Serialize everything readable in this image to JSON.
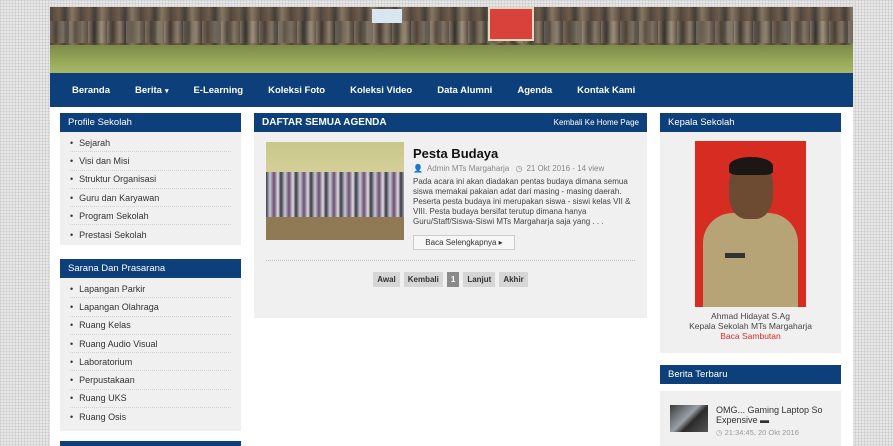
{
  "nav": {
    "items": [
      {
        "label": "Beranda"
      },
      {
        "label": "Berita",
        "caret": "▾"
      },
      {
        "label": "E-Learning"
      },
      {
        "label": "Koleksi Foto"
      },
      {
        "label": "Koleksi Video"
      },
      {
        "label": "Data Alumni"
      },
      {
        "label": "Agenda"
      },
      {
        "label": "Kontak Kami"
      }
    ]
  },
  "sidebar": {
    "profile_title": "Profile Sekolah",
    "profile_items": [
      "Sejarah",
      "Visi dan Misi",
      "Struktur Organisasi",
      "Guru dan Karyawan",
      "Program Sekolah",
      "Prestasi Sekolah"
    ],
    "sarana_title": "Sarana Dan Prasarana",
    "sarana_items": [
      "Lapangan Parkir",
      "Lapangan Olahraga",
      "Ruang Kelas",
      "Ruang Audio Visual",
      "Laboratorium",
      "Perpustakaan",
      "Ruang UKS",
      "Ruang Osis"
    ]
  },
  "agenda": {
    "title": "DAFTAR SEMUA AGENDA",
    "back_label": "Kembali Ke Home Page",
    "post": {
      "title": "Pesta Budaya",
      "author": "Admin MTs Margaharja",
      "date": "21 Okt 2016 - 14 view",
      "excerpt": "Pada acara ini akan diadakan pentas budaya dimana semua siswa memakai pakaian adat dari masing - masing daerah. Peserta pesta budaya ini merupakan siswa - siswi kelas VII & VIII. Pesta budaya bersifat terutup dimana hanya Guru/Staff/Siswa-Siswi MTs Margaharja saja yang . . .",
      "read_more": "Baca Selengkapnya ▸"
    },
    "pager": [
      "Awal",
      "Kembali",
      "1",
      "Lanjut",
      "Akhir"
    ]
  },
  "kepala": {
    "title": "Kepala Sekolah",
    "name": "Ahmad Hidayat S.Ag",
    "role": "Kepala Sekolah MTs Margaharja",
    "link": "Baca Sambutan"
  },
  "berita": {
    "title": "Berita Terbaru",
    "item_title": "OMG... Gaming Laptop So Expensive",
    "item_time": "21:34:45, 20 Okt 2016"
  },
  "icons": {
    "user": "user-icon",
    "clock": "clock-icon",
    "bullet": "•"
  },
  "colors": {
    "primary": "#0d3f7a",
    "link_red": "#d52a2a",
    "panel": "#f0f0f0"
  }
}
